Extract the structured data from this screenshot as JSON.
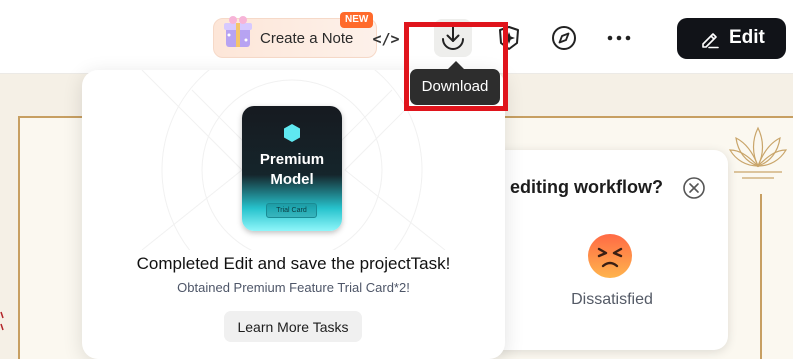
{
  "toolbar": {
    "create_note_label": "Create a Note",
    "new_badge": "NEW",
    "code_label": "</>",
    "download_tooltip": "Download",
    "edit_label": "Edit",
    "icons": [
      "gift-icon",
      "code-icon",
      "download-icon",
      "ai-sparkle-icon",
      "compass-icon",
      "more-icon",
      "pencil-icon"
    ]
  },
  "reward_popup": {
    "card_title": "Premium Model",
    "card_chip": "Trial Card",
    "headline": "Completed Edit and save the projectTask!",
    "subtext": "Obtained Premium Feature Trial Card*2!",
    "button_label": "Learn More Tasks"
  },
  "survey": {
    "question": "editing workflow?",
    "option_label": "Dissatisfied",
    "emoji": "angry-face-icon"
  },
  "colors": {
    "highlight": "#e0141c",
    "edit_button": "#111318",
    "new_badge": "#ff6a2b",
    "premium_accent": "#27c3cd"
  }
}
